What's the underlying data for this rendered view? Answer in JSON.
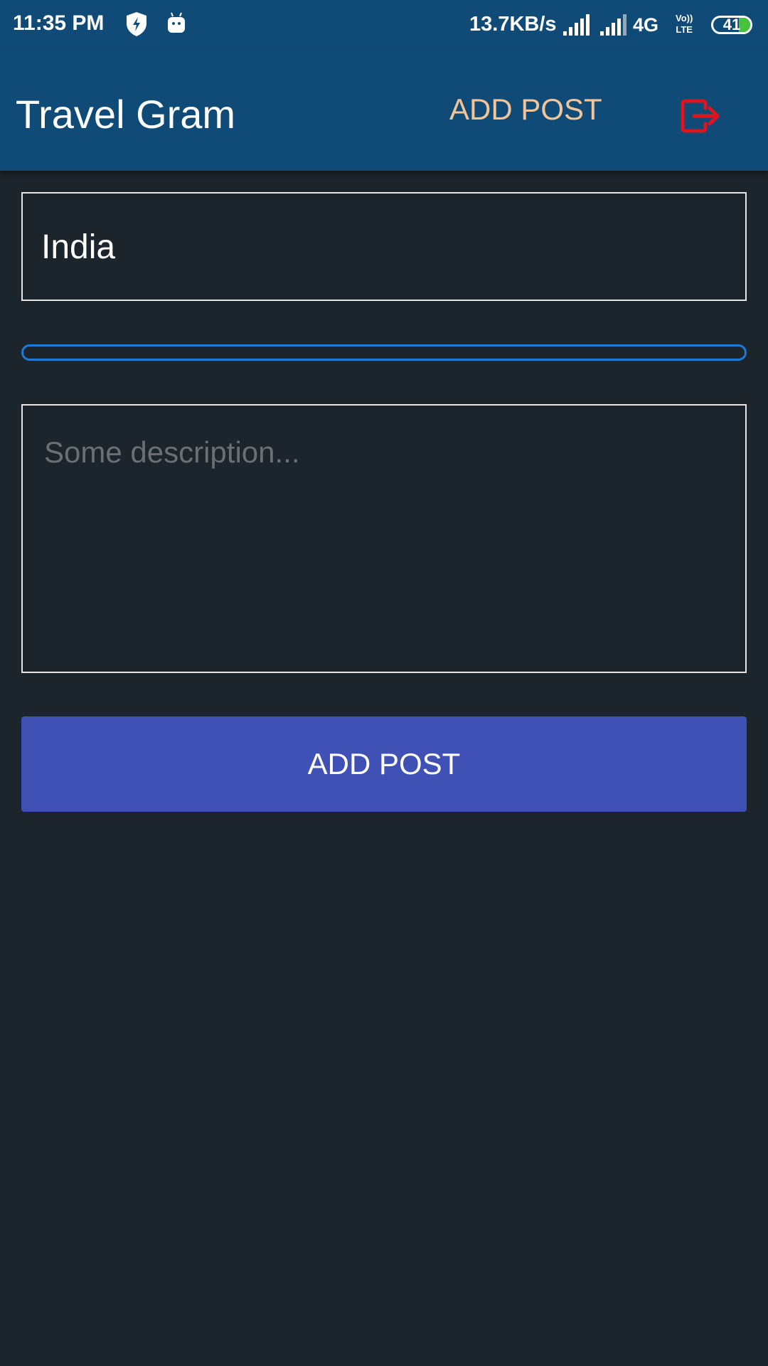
{
  "status_bar": {
    "time": "11:35 PM",
    "net_speed": "13.7KB/s",
    "network": "4G",
    "volte_top": "Vo))",
    "volte_bottom": "LTE",
    "battery": "41",
    "battery_level_percent": 41,
    "icons": [
      "shield-bolt-icon",
      "android-icon",
      "signal-icon",
      "signal-icon"
    ]
  },
  "app_bar": {
    "title": "Travel Gram",
    "add_post_label": "ADD POST",
    "logout_icon": "logout-icon",
    "colors": {
      "background": "#0f4b76",
      "add_post": "#f2c49b",
      "logout": "#e0141e"
    }
  },
  "form": {
    "location_value": "India",
    "upload_progress_percent": 0,
    "description_placeholder": "Some description...",
    "submit_label": "ADD POST",
    "colors": {
      "background": "#1c252c",
      "progress": "#1e7ad7",
      "submit": "#4051b5"
    }
  }
}
